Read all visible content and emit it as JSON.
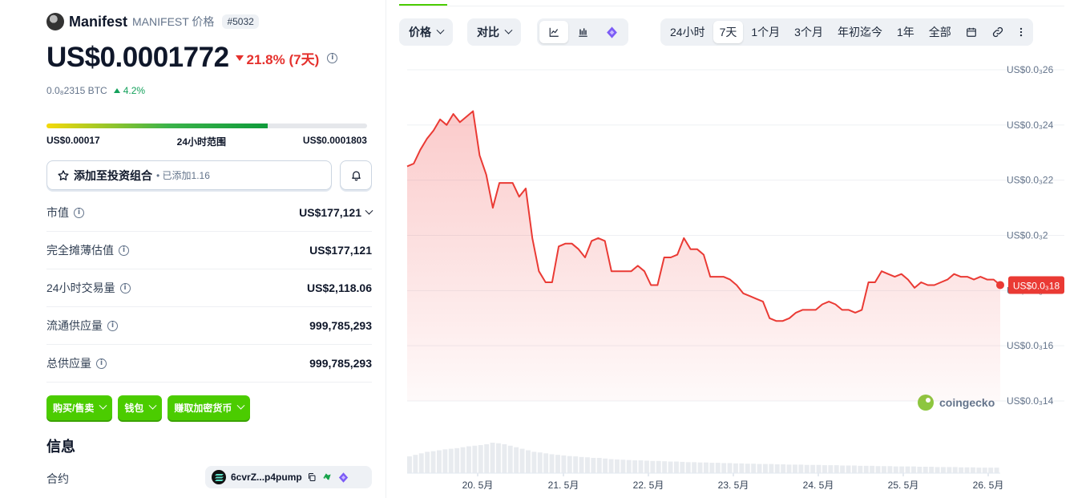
{
  "coin": {
    "name": "Manifest",
    "symbol_label": "MANIFEST 价格",
    "rank": "#5032",
    "price": "US$0.0001772",
    "change_7d": "21.8% (7天)",
    "btc_price": "0.0₈2315 BTC",
    "btc_change": "4.2%"
  },
  "range24h": {
    "low": "US$0.00017",
    "label": "24小时范围",
    "high": "US$0.0001803",
    "fill_percent": 69
  },
  "portfolio": {
    "label": "添加至投资组合",
    "added": "• 已添加1.16"
  },
  "stats": [
    {
      "key": "市值",
      "value": "US$177,121",
      "expandable": true
    },
    {
      "key": "完全摊薄估值",
      "value": "US$177,121",
      "expandable": false
    },
    {
      "key": "24小时交易量",
      "value": "US$2,118.06",
      "expandable": false
    },
    {
      "key": "流通供应量",
      "value": "999,785,293",
      "expandable": false
    },
    {
      "key": "总供应量",
      "value": "999,785,293",
      "expandable": false
    }
  ],
  "actions": [
    "购买/售卖",
    "钱包",
    "赚取加密货币"
  ],
  "info": {
    "title": "信息",
    "contract_label": "合约",
    "contract_value": "6cvrZ...p4pump"
  },
  "toolbar": {
    "price_dd": "价格",
    "compare_dd": "对比",
    "ranges": [
      "24小时",
      "7天",
      "1个月",
      "3个月",
      "年初迄今",
      "1年",
      "全部"
    ],
    "active_range": "7天"
  },
  "colors": {
    "accent": "#4bcc00",
    "down": "#e5312d",
    "up": "#14a15b",
    "line": "#ea3a34"
  },
  "icons": [
    "star-icon",
    "bell-icon",
    "info-icon",
    "line-chart-icon",
    "candle-chart-icon",
    "tradingview-icon",
    "calendar-icon",
    "link-icon",
    "more-icon",
    "copy-icon",
    "metamask-icon",
    "solana-icon"
  ],
  "chart_data": {
    "type": "area",
    "series": [
      {
        "values": [
          2.25e-05,
          2.26e-05,
          2.31e-05,
          2.35e-05,
          2.38e-05,
          2.42e-05,
          2.4e-05,
          2.44e-05,
          2.41e-05,
          2.43e-05,
          2.45e-05,
          2.29e-05,
          2.22e-05,
          2.1e-05,
          2.19e-05,
          2.19e-05,
          2.19e-05,
          2.14e-05,
          2.17e-05,
          1.99e-05,
          1.87e-05,
          1.83e-05,
          1.83e-05,
          1.96e-05,
          1.97e-05,
          1.97e-05,
          1.95e-05,
          1.92e-05,
          1.98e-05,
          1.99e-05,
          1.98e-05,
          1.87e-05,
          1.87e-05,
          1.87e-05,
          1.87e-05,
          1.89e-05,
          1.87e-05,
          1.82e-05,
          1.82e-05,
          1.92e-05,
          1.92e-05,
          1.93e-05,
          1.99e-05,
          1.95e-05,
          1.95e-05,
          1.93e-05,
          1.85e-05,
          1.85e-05,
          1.85e-05,
          1.84e-05,
          1.82e-05,
          1.79e-05,
          1.78e-05,
          1.77e-05,
          1.76e-05,
          1.7e-05,
          1.69e-05,
          1.69e-05,
          1.7e-05,
          1.72e-05,
          1.73e-05,
          1.73e-05,
          1.73e-05,
          1.75e-05,
          1.76e-05,
          1.75e-05,
          1.73e-05,
          1.73e-05,
          1.72e-05,
          1.73e-05,
          1.83e-05,
          1.83e-05,
          1.87e-05,
          1.86e-05,
          1.85e-05,
          1.86e-05,
          1.84e-05,
          1.81e-05,
          1.83e-05,
          1.82e-05,
          1.82e-05,
          1.83e-05,
          1.84e-05,
          1.86e-05,
          1.85e-05,
          1.85e-05,
          1.84e-05,
          1.85e-05,
          1.84e-05,
          1.84e-05,
          1.82e-05
        ],
        "last_label": "US$0.0₃18"
      }
    ],
    "x_ticks": [
      "20. 5月",
      "21. 5月",
      "22. 5月",
      "23. 5月",
      "24. 5月",
      "25. 5月",
      "26. 5月"
    ],
    "y_ticks": [
      "US$0.0₃26",
      "US$0.0₃24",
      "US$0.0₃22",
      "US$0.0₃2",
      "US$0.0₃18",
      "US$0.0₃16",
      "US$0.0₃14"
    ],
    "y_tick_values": [
      2.6e-05,
      2.4e-05,
      2.2e-05,
      2e-05,
      1.8e-05,
      1.6e-05,
      1.4e-05
    ],
    "ylim": [
      1.4e-05,
      2.6e-05
    ],
    "watermark": "coingecko",
    "volume": [
      0.55,
      0.6,
      0.65,
      0.7,
      0.72,
      0.75,
      0.78,
      0.8,
      0.82,
      0.85,
      0.88,
      0.9,
      0.92,
      0.95,
      1.0,
      0.98,
      0.95,
      0.9,
      0.85,
      0.8,
      0.75,
      0.7,
      0.68,
      0.65,
      0.62,
      0.6,
      0.58,
      0.56,
      0.55,
      0.53,
      0.52,
      0.5,
      0.5,
      0.48,
      0.46,
      0.45,
      0.44,
      0.43,
      0.42,
      0.42,
      0.41,
      0.4,
      0.4,
      0.39,
      0.38,
      0.38,
      0.37,
      0.36,
      0.36,
      0.35,
      0.35,
      0.34,
      0.34,
      0.33,
      0.33,
      0.32,
      0.32,
      0.31,
      0.31,
      0.3,
      0.3,
      0.3,
      0.29,
      0.29,
      0.28,
      0.28,
      0.28,
      0.27,
      0.27,
      0.27,
      0.26,
      0.26,
      0.26,
      0.25,
      0.25,
      0.25,
      0.24,
      0.24,
      0.24,
      0.23,
      0.23,
      0.23,
      0.22,
      0.22,
      0.22,
      0.22,
      0.21,
      0.21,
      0.21,
      0.2,
      0.2,
      0.2,
      0.2,
      0.19,
      0.19,
      0.19,
      0.18,
      0.18,
      0.18,
      0.18
    ]
  }
}
